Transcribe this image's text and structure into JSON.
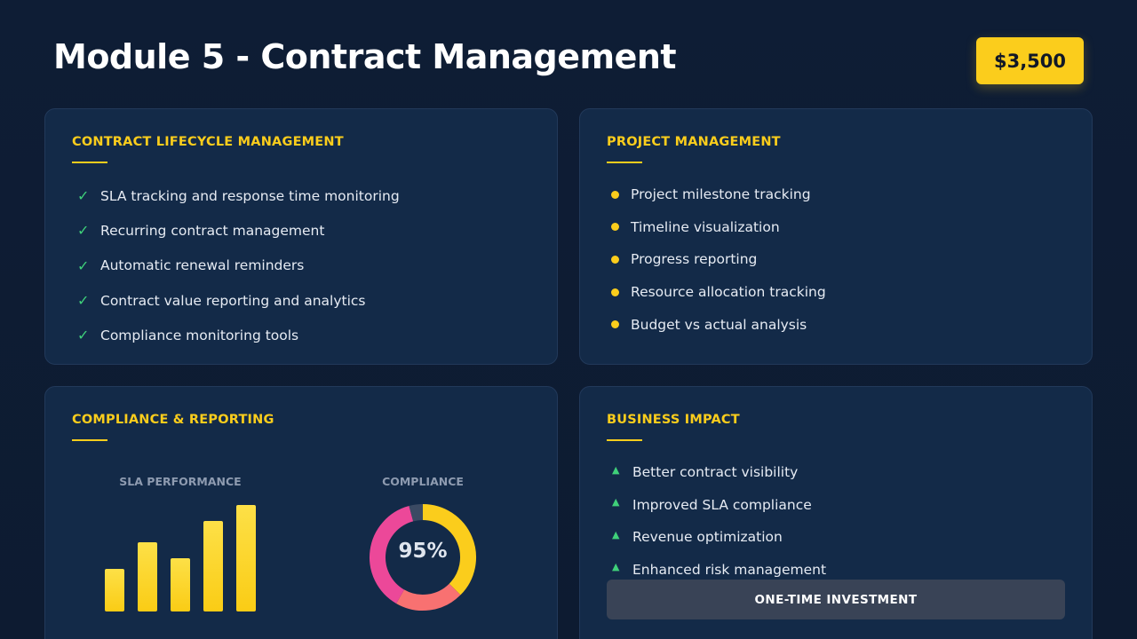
{
  "header": {
    "title": "Module 5 - Contract Management",
    "price": "$3,500"
  },
  "contract_lifecycle": {
    "heading": "CONTRACT LIFECYCLE MANAGEMENT",
    "items": [
      "SLA tracking and response time monitoring",
      "Recurring contract management",
      "Automatic renewal reminders",
      "Contract value reporting and analytics",
      "Compliance monitoring tools"
    ]
  },
  "project_management": {
    "heading": "PROJECT MANAGEMENT",
    "items": [
      "Project milestone tracking",
      "Timeline visualization",
      "Progress reporting",
      "Resource allocation tracking",
      "Budget vs actual analysis"
    ]
  },
  "compliance_reporting": {
    "heading": "COMPLIANCE & REPORTING",
    "sla_label": "SLA PERFORMANCE",
    "compliance_label": "COMPLIANCE",
    "compliance_value": "95%"
  },
  "business_impact": {
    "heading": "BUSINESS IMPACT",
    "items": [
      "Better contract visibility",
      "Improved SLA compliance",
      "Revenue optimization",
      "Enhanced risk management"
    ],
    "button": "ONE-TIME INVESTMENT"
  },
  "chart_data": [
    {
      "type": "bar",
      "title": "SLA PERFORMANCE",
      "values": [
        40,
        65,
        50,
        85,
        100
      ],
      "ylim": [
        0,
        100
      ],
      "grid": false,
      "color": "#fbcd1c"
    },
    {
      "type": "pie",
      "title": "COMPLIANCE",
      "center_label": "95%",
      "values": [
        45,
        25,
        45,
        5
      ],
      "colors": [
        "#fbcd1c",
        "#f87171",
        "#ec4899",
        "#3b4a63"
      ]
    }
  ],
  "colors": {
    "background": "#0e1d35",
    "card": "#132a48",
    "accent": "#fbcd1c",
    "success": "#3fd07a",
    "button": "#394356"
  },
  "icons": {
    "check": "✓",
    "triangle": "▲"
  }
}
